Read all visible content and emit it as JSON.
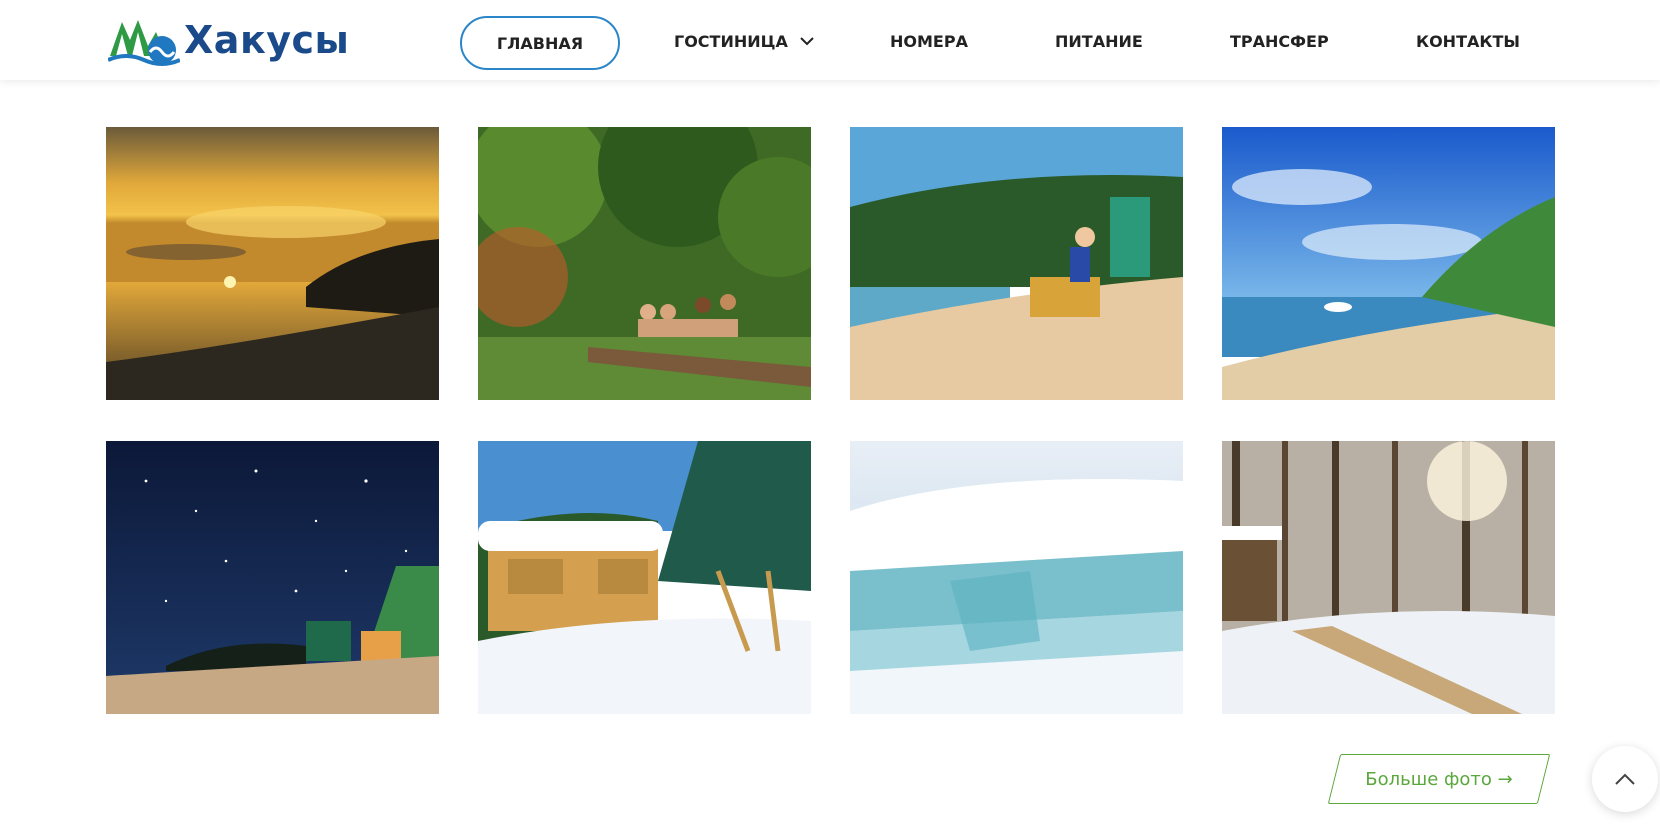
{
  "brand": {
    "name": "Хакусы",
    "logo_icon": "mountains-waves-logo"
  },
  "nav": {
    "items": [
      {
        "label": "ГЛАВНАЯ",
        "active": true
      },
      {
        "label": "ГОСТИНИЦА",
        "has_dropdown": true
      },
      {
        "label": "НОМЕРА"
      },
      {
        "label": "ПИТАНИЕ"
      },
      {
        "label": "ТРАНСФЕР"
      },
      {
        "label": "КОНТАКТЫ"
      }
    ]
  },
  "gallery": {
    "photos": [
      {
        "subject": "sunset-over-lake"
      },
      {
        "subject": "people-at-hot-spring"
      },
      {
        "subject": "woman-on-beach-chair"
      },
      {
        "subject": "beach-with-boat"
      },
      {
        "subject": "night-sky-cabins"
      },
      {
        "subject": "snowy-gazebo"
      },
      {
        "subject": "ice-hummocks"
      },
      {
        "subject": "winter-hot-spring-steam"
      }
    ]
  },
  "more_button": {
    "label": "Больше фото →"
  },
  "colors": {
    "accent_blue": "#2a86c8",
    "brand_navy": "#1a4a8a",
    "accent_green": "#5aa83c"
  },
  "icons": {
    "dropdown": "chevron-down-icon",
    "scroll_top": "chevron-up-icon"
  }
}
